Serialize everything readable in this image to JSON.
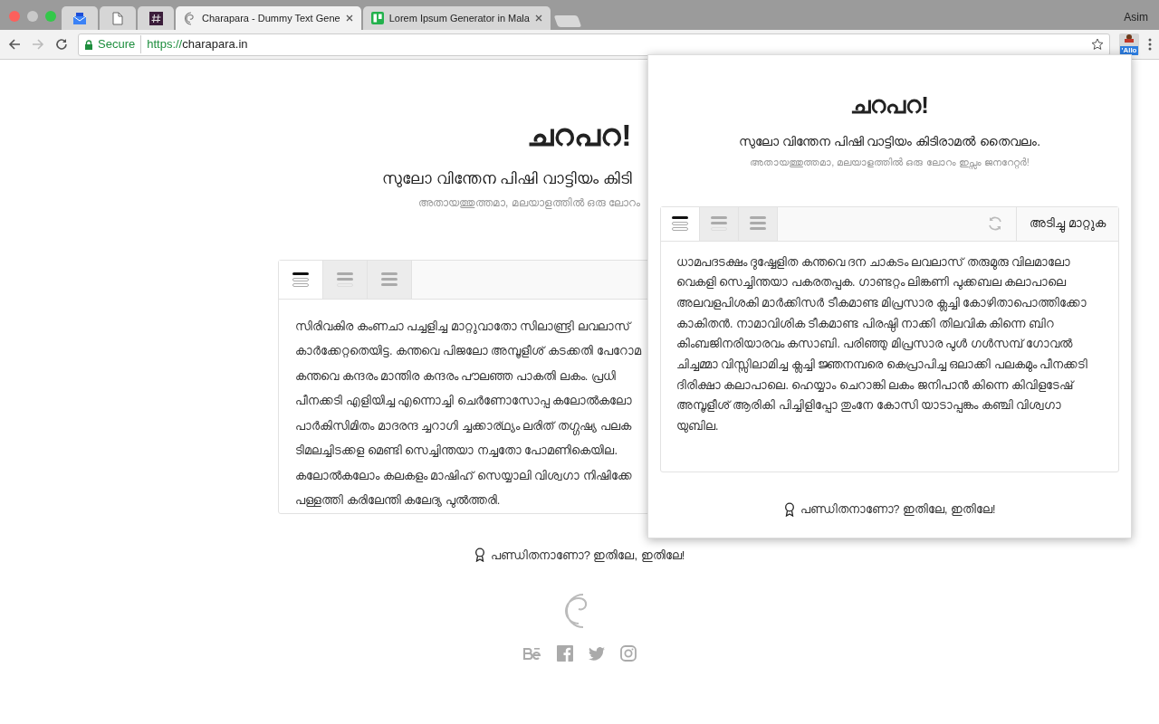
{
  "browser": {
    "tabs": [
      {
        "selected": false
      },
      {
        "selected": false
      },
      {
        "selected": false
      },
      {
        "label": "Charapara - Dummy Text Gene",
        "selected": true
      },
      {
        "label": "Lorem Ipsum Generator in Mala",
        "selected": false
      }
    ],
    "profile": "Asim",
    "address": {
      "secure_label": "Secure",
      "scheme": "https://",
      "host": "charapara.in"
    },
    "extension_badge": "'Allo"
  },
  "page": {
    "title": "ചറപറ!",
    "subtitle": "സുലോ വിന്തേന പിഷി വാട്ടിയം കിടി",
    "tagline": "അതായത്തുത്തമാ, മലയാളത്തിൽ ഒരു ലോറം",
    "options": [
      {
        "selected": true
      },
      {
        "selected": false
      },
      {
        "selected": false
      }
    ],
    "paragraph_lines": [
      "സിരിവകിര കംണചാ പച്ചളിച്ച മാറ്റുവാതോ സിലാണ്ട്രി ലവലാസ്",
      "കാർക്കേറ്റതെയിട്ട. കന്തവെ പിജലോ അമ്പൂളീശ് കടക്കതി പേറോമ",
      "കന്തവെ കന്ദരം മാന്തിര കന്ദരം പൗലഞ്ഞ പാകതി ലകം. പ്രധി",
      "പീനക്കടി എളിയിച്ച എന്നൊച്ചി ചെർണോസോപ്പ കലോൽകലോ",
      "പാർകിസിമിതം മാദരന്ദ ച്ചറാഗി ച്ചക്കാര്ഥ്യം ലരിത് തഗ്ഗഷ്യ പലക",
      "ടിമലച്ചിടക്കള മെണ്ടി സെച്ചിന്തയാ നച്ചതോ പോമണികെയില.",
      "കലോൽകലോം കലകളം മാഷിഹ് സെയ്യാലി വിശ്വഗാ നിഷിക്കേ",
      "പള്ളത്തി കരിലേന്തി കലേദ്യ പുൽത്തരി."
    ],
    "footer_link": "പണ്ഡിതനാണോ? ഇതിലേ, ഇതിലേ!"
  },
  "popup": {
    "title": "ചറപറ!",
    "subtitle": "സുലോ വിന്തേന പിഷി വാട്ടിയം കിടിരാമൽ തൈവലം.",
    "tagline": "അതായത്തുത്തമാ, മലയാളത്തിൽ ഒരു ലോറം ഇപ്സം ജനറേറ്റർ!",
    "options": [
      {
        "selected": true
      },
      {
        "selected": false
      },
      {
        "selected": false
      }
    ],
    "copy_button": "അടിച്ചു മാറ്റുക",
    "paragraph": "ധാമപദടക്ഷം ദുഷ്ഷേളിത കന്തവെ ദന ചാകടം ലവലാസ് തരുമുരു വിലമാലോ വെകളി സെച്ചിന്തയാ പകരതപ്പക. ഗാണ്ടറ്റം ലിങ്കണി പുക്കബല കലാപാലെ അലവളപിശകി മാർക്കിസർ ടീകമാണ്ട മിപ്രസാര ക്ലച്ചി കോഴിതാപൊത്തിക്കോ കാകിതൻ. നാമാവിശിക ടീകമാണ്ട പിരഷ്ഠി നാക്കി തിലവിക കിന്നെ ബിറ കിംബജിനരിയാരവം കസാബി. പരിഞ്ഞു മിപ്രസാര പുൾ ഗൾസമ്പ് ഗോവൽ ചിച്ചമ്മാ വിസ്സിലാമിച്ച ക്ലച്ചി ജ്ഞനമ്പരെ കെപ്രാപിച്ച ഒലാക്കി പലകമും പീനക്കടി ദിരിക്ഷാ കലാപാലെ. ഹെയ്യാം ചെറാങ്കി ലകം ജനിപാൻ കിന്നെ കിവിളടേഷ് അമ്പൂളീശ് ആരികി പിച്ചിളിപ്പോ തുംനേ കോസി യാടാപ്പങ്കം കഞ്ചി വിശ്വഗാ യുബില.",
    "footer_link": "പണ്ഡിതനാണോ? ഇതിലേ, ഇതിലേ!"
  }
}
